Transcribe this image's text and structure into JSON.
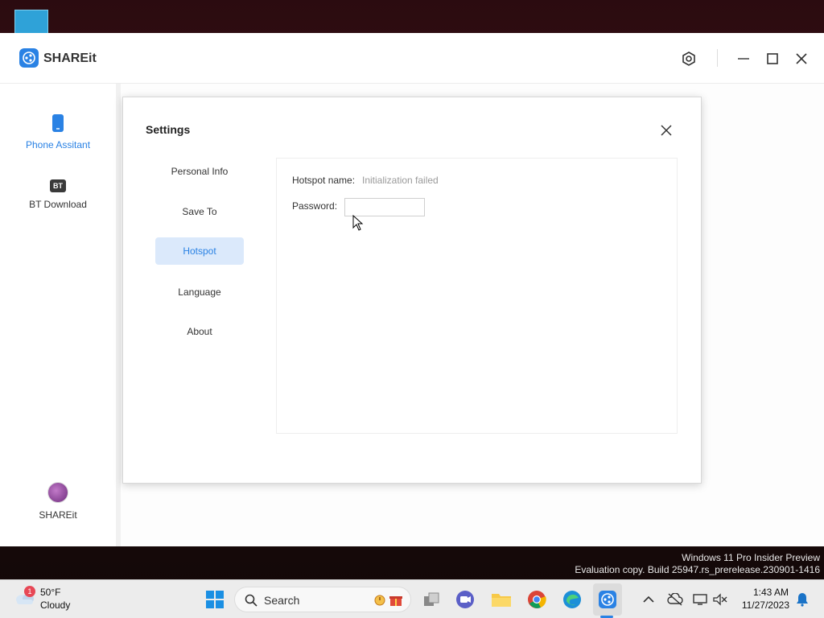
{
  "app": {
    "name": "SHAREit",
    "brand_color": "#2a82e4"
  },
  "sidebar": {
    "items": [
      {
        "label": "Phone Assitant",
        "icon": "phone-icon",
        "active": true
      },
      {
        "label": "BT Download",
        "icon": "bt-icon",
        "badge_text": "BT"
      }
    ],
    "bottom": {
      "label": "SHAREit",
      "icon": "avatar"
    }
  },
  "dialog": {
    "title": "Settings",
    "nav": [
      {
        "label": "Personal Info"
      },
      {
        "label": "Save To"
      },
      {
        "label": "Hotspot",
        "active": true
      },
      {
        "label": "Language"
      },
      {
        "label": "About"
      }
    ],
    "hotspot": {
      "name_label": "Hotspot name:",
      "name_value": "Initialization failed",
      "password_label": "Password:",
      "password_value": ""
    }
  },
  "watermark": {
    "line1": "Windows 11 Pro Insider Preview",
    "line2": "Evaluation copy. Build 25947.rs_prerelease.230901-1416"
  },
  "taskbar": {
    "weather": {
      "temp": "50°F",
      "condition": "Cloudy",
      "badge": "1"
    },
    "search_placeholder": "Search",
    "clock": {
      "time": "1:43 AM",
      "date": "11/27/2023"
    }
  }
}
